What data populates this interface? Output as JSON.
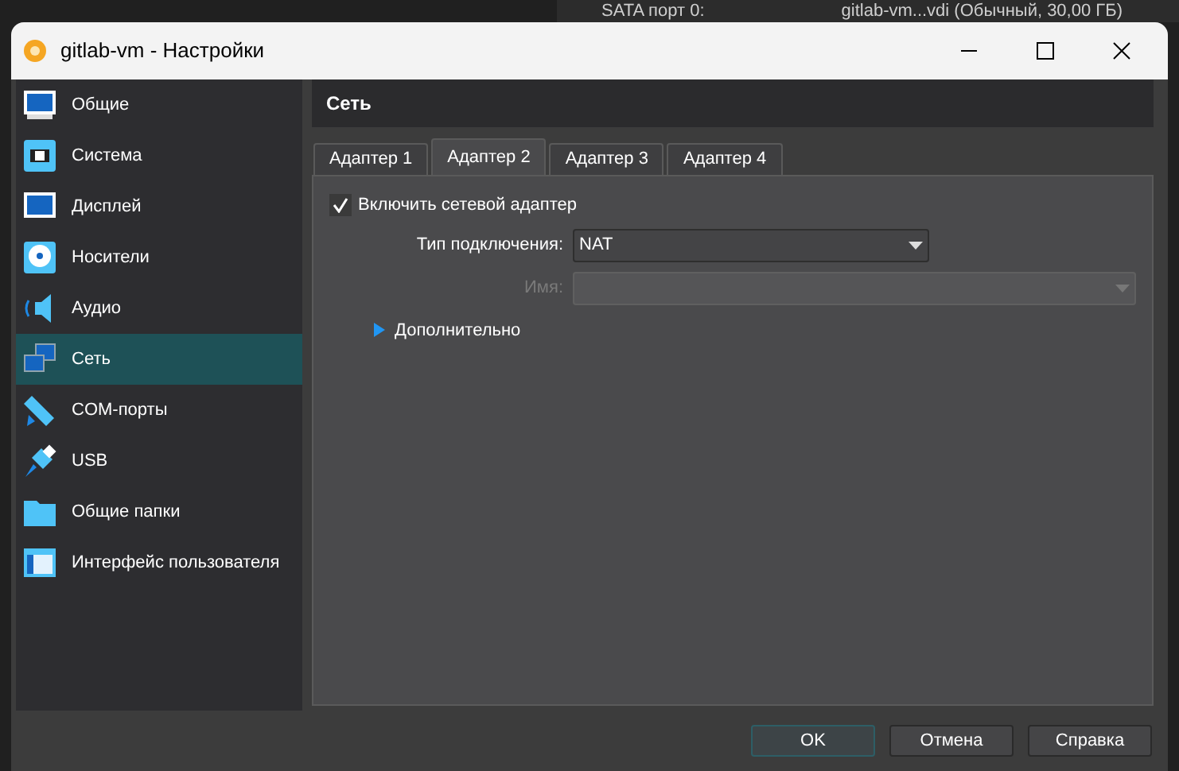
{
  "background_window": {
    "texts": [
      "SATA порт 0:",
      "gitlab-vm...vdi (Обычный, 30,00 ГБ)"
    ]
  },
  "window": {
    "title": "gitlab-vm - Настройки"
  },
  "sidebar": {
    "items": [
      {
        "label": "Общие",
        "selected": false
      },
      {
        "label": "Система",
        "selected": false
      },
      {
        "label": "Дисплей",
        "selected": false
      },
      {
        "label": "Носители",
        "selected": false
      },
      {
        "label": "Аудио",
        "selected": false
      },
      {
        "label": "Сеть",
        "selected": true
      },
      {
        "label": "COM-порты",
        "selected": false
      },
      {
        "label": "USB",
        "selected": false
      },
      {
        "label": "Общие папки",
        "selected": false
      },
      {
        "label": "Интерфейс пользователя",
        "selected": false
      }
    ]
  },
  "page": {
    "title": "Сеть",
    "tabs": [
      {
        "label": "Адаптер 1",
        "selected": false
      },
      {
        "label": "Адаптер 2",
        "selected": true
      },
      {
        "label": "Адаптер 3",
        "selected": false
      },
      {
        "label": "Адаптер 4",
        "selected": false
      }
    ],
    "enable_adapter": {
      "label": "Включить сетевой адаптер",
      "checked": true
    },
    "fields": [
      {
        "label": "Тип подключения:",
        "value": "NAT",
        "disabled": false
      },
      {
        "label": "Имя:",
        "disabled": true
      }
    ],
    "advanced": {
      "label": "Дополнительно",
      "expanded": false
    }
  },
  "buttons": [
    {
      "label": "OK",
      "default": true
    },
    {
      "label": "Отмена",
      "default": false
    },
    {
      "label": "Справка",
      "default": false
    }
  ]
}
